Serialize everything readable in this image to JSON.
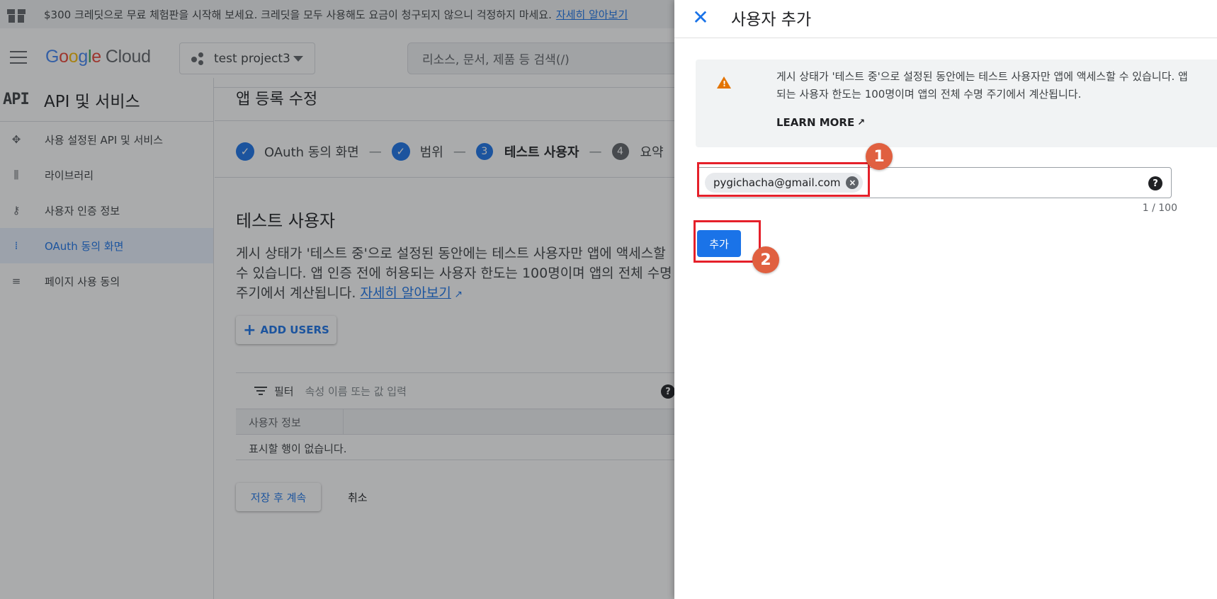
{
  "promo": {
    "text": "$300 크레딧으로 무료 체험판을 시작해 보세요. 크레딧을 모두 사용해도 요금이 청구되지 않으니 걱정하지 마세요.",
    "link": "자세히 알아보기"
  },
  "topbar": {
    "logo_cloud": "Cloud",
    "project": "test project3",
    "search_placeholder": "리소스, 문서, 제품 등 검색(/)"
  },
  "sidebar": {
    "logo": "API",
    "title": "API 및 서비스",
    "items": [
      {
        "label": "사용 설정된 API 및 서비스",
        "icon": "diamond-grid-icon"
      },
      {
        "label": "라이브러리",
        "icon": "library-icon"
      },
      {
        "label": "사용자 인증 정보",
        "icon": "key-icon"
      },
      {
        "label": "OAuth 동의 화면",
        "icon": "consent-icon"
      },
      {
        "label": "페이지 사용 동의",
        "icon": "settings-list-icon"
      }
    ]
  },
  "main": {
    "title": "앱 등록 수정",
    "steps": [
      {
        "label": "OAuth 동의 화면",
        "state": "done"
      },
      {
        "label": "범위",
        "state": "done"
      },
      {
        "num": "3",
        "label": "테스트 사용자",
        "state": "current"
      },
      {
        "num": "4",
        "label": "요약",
        "state": "todo"
      }
    ],
    "section_title": "테스트 사용자",
    "desc_line1": "게시 상태가 '테스트 중'으로 설정된 동안에는 테스트 사용자만 앱에 액세스할",
    "desc_line2": "수 있습니다. 앱 인증 전에 허용되는 사용자 한도는 100명이며 앱의 전체 수명",
    "desc_line3": "주기에서 계산됩니다.",
    "desc_link": "자세히 알아보기",
    "add_users": "ADD USERS",
    "filter_label": "필터",
    "filter_placeholder": "속성 이름 또는 값 입력",
    "table_col": "사용자 정보",
    "table_empty": "표시할 행이 없습니다.",
    "save": "저장 후 계속",
    "cancel": "취소"
  },
  "panel": {
    "title": "사용자 추가",
    "notice_line1": "게시 상태가 '테스트 중'으로 설정된 동안에는 테스트 사용자만 앱에 액세스할 수 있습니다. 앱",
    "notice_line2": "되는 사용자 한도는 100명이며 앱의 전체 수명 주기에서 계산됩니다.",
    "learn_more": "LEARN MORE",
    "chip_email": "pygichacha@gmail.com",
    "counter": "1 / 100",
    "add_button": "추가"
  },
  "annotations": {
    "badge1": "1",
    "badge2": "2",
    "color": "#e5202a"
  }
}
